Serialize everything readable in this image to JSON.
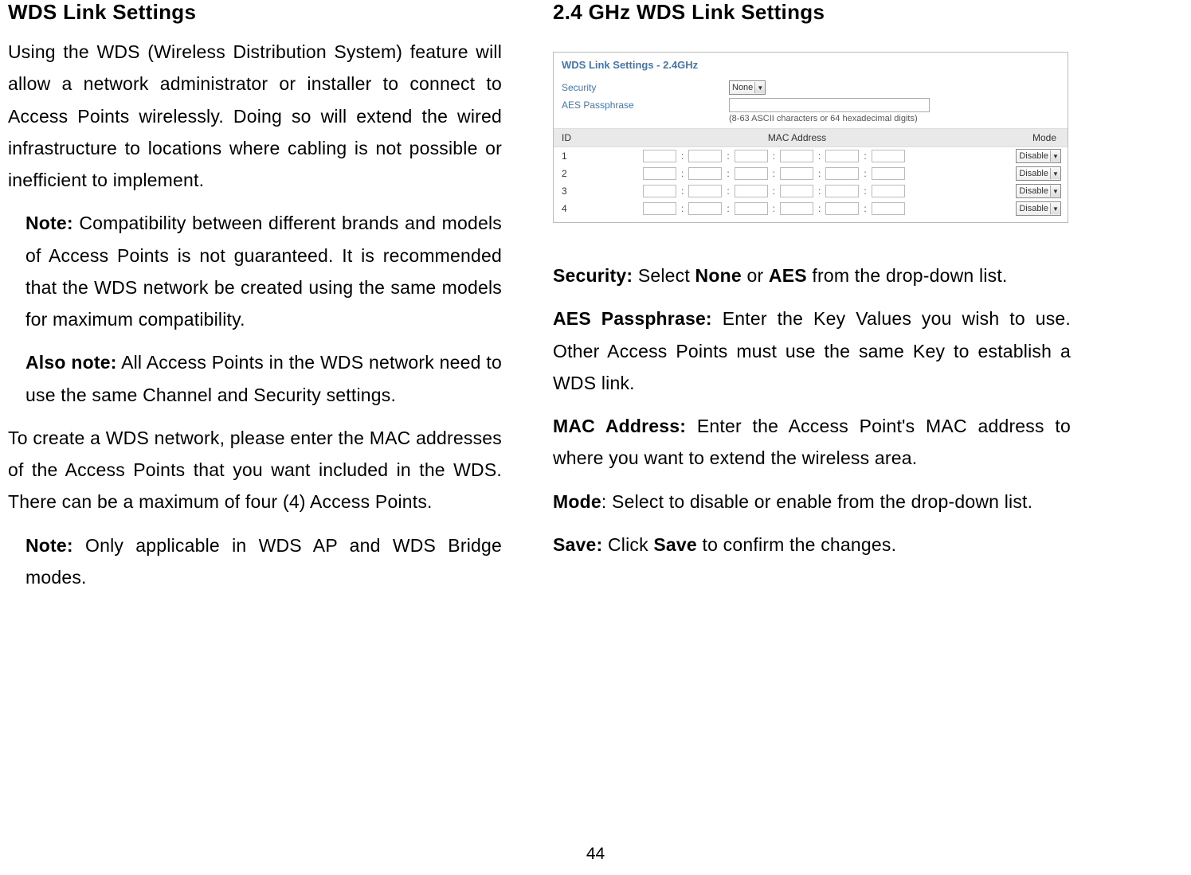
{
  "left": {
    "title": "WDS Link Settings",
    "p1": "Using the WDS (Wireless Distribution System) feature will allow a network administrator or installer to connect to Access Points wirelessly. Doing so will extend the wired infrastructure to locations where cabling is not possible or inefficient to implement.",
    "note1_label": "Note:",
    "note1_text": " Compatibility between different brands and models of Access Points is not guaranteed. It is recommended that the WDS network be created using the same models for maximum compatibility.",
    "note2_label": "Also note:",
    "note2_text": " All Access Points in the WDS network need to use the same Channel and Security settings.",
    "p2": "To create a WDS network, please enter the MAC addresses of the Access Points that you want included in the WDS. There can be a maximum of four (4) Access Points.",
    "note3_label": "Note:",
    "note3_text": " Only applicable in WDS AP and WDS Bridge modes."
  },
  "right": {
    "title": "2.4 GHz WDS Link Settings",
    "panel": {
      "title": "WDS Link Settings - 2.4GHz",
      "security_label": "Security",
      "security_value": "None",
      "aes_label": "AES Passphrase",
      "aes_hint": "(8-63 ASCII characters or 64 hexadecimal digits)",
      "headers": {
        "id": "ID",
        "mac": "MAC Address",
        "mode": "Mode"
      },
      "rows": [
        {
          "id": "1",
          "mode": "Disable"
        },
        {
          "id": "2",
          "mode": "Disable"
        },
        {
          "id": "3",
          "mode": "Disable"
        },
        {
          "id": "4",
          "mode": "Disable"
        }
      ]
    },
    "desc": {
      "security_label": "Security:",
      "security_text": " Select ",
      "security_none": "None",
      "security_or": " or ",
      "security_aes": "AES",
      "security_rest": " from the drop-down list.",
      "aes_label": "AES Passphrase:",
      "aes_text": " Enter the Key Values you wish to use. Other Access Points must use the same Key to establish a WDS link.",
      "mac_label": "MAC Address:",
      "mac_text": " Enter the Access Point's MAC address to where you want to extend the wireless area.",
      "mode_label": "Mode",
      "mode_text": ": Select to disable or enable from the drop-down list.",
      "save_label": "Save:",
      "save_text": " Click ",
      "save_word": "Save",
      "save_rest": " to confirm the changes."
    }
  },
  "page_number": "44"
}
